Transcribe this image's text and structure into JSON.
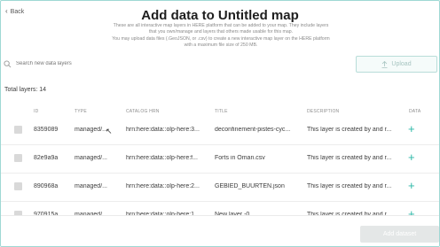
{
  "header": {
    "back_label": "Back",
    "title": "Add data to Untitled map",
    "description_lines": [
      "These are all interactive map layers in HERE platform that can be added to your map. They include layers",
      "that you own/manage and layers that others made usable for this map.",
      "You may upload data files (.GeoJSON, or .csv) to create a new interactive map layer on the HERE platform",
      "with a maximum file size of 250 MB."
    ]
  },
  "search": {
    "placeholder": "Search new data layers"
  },
  "upload_label": "Upload",
  "total_label": "Total layers: 14",
  "table": {
    "columns": [
      "ID",
      "TYPE",
      "CATALOG HRN",
      "TITLE",
      "DESCRIPTION",
      "DATA"
    ],
    "rows": [
      {
        "id": "8359089",
        "type": "managed/...",
        "hrn": "hrn:here:data::olp-here:3...",
        "title": "deconfinement-pistes-cyc...",
        "description": "This layer is created by and r..."
      },
      {
        "id": "82e9a9a",
        "type": "managed/...",
        "hrn": "hrn:here:data::olp-here:f...",
        "title": "Forts in Oman.csv",
        "description": "This layer is created by and r..."
      },
      {
        "id": "890968a",
        "type": "managed/...",
        "hrn": "hrn:here:data::olp-here:2...",
        "title": "GEBIED_BUURTEN.json",
        "description": "This layer is created by and r..."
      },
      {
        "id": "970915a",
        "type": "managed/...",
        "hrn": "hrn:here:data::olp-here:1...",
        "title": "New layer -0",
        "description": "This layer is created by and r..."
      }
    ]
  },
  "footer": {
    "add_label": "Add dataset"
  },
  "colors": {
    "accent": "#2bb7a7",
    "border": "#9fd8d4"
  },
  "icons": {
    "back": "chevron-left-icon",
    "search": "search-icon",
    "upload": "upload-icon",
    "add": "plus-icon"
  }
}
